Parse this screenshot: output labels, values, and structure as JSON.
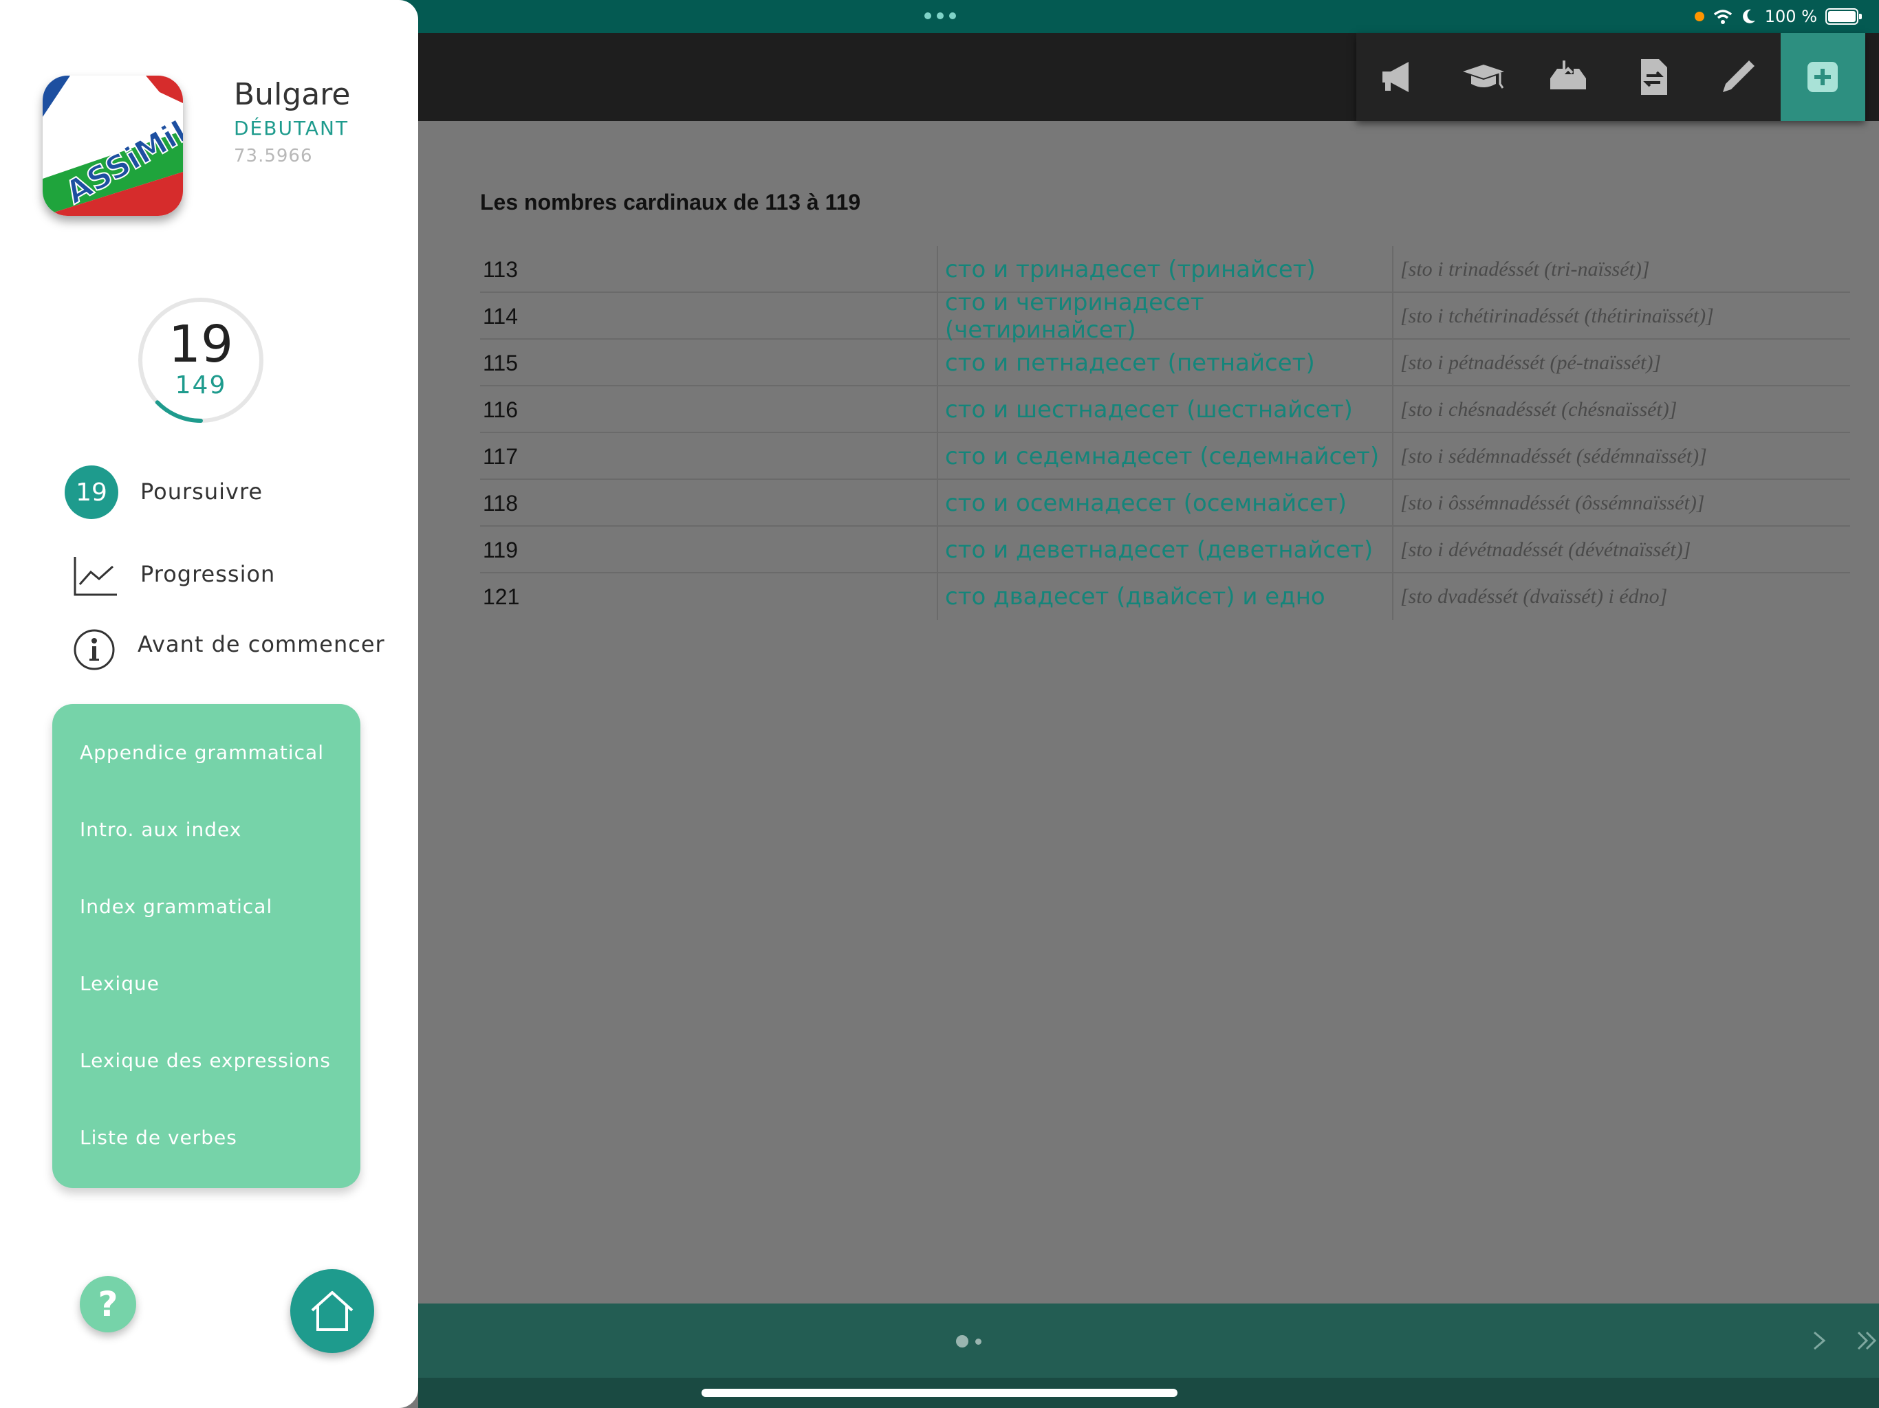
{
  "status_bar": {
    "battery_text": "100 %"
  },
  "colors": {
    "accent": "#1e9b8d",
    "panel_green": "#76d3a9",
    "status_teal": "#045a52"
  },
  "sidebar": {
    "logo_text": "ASSiMiL",
    "course_title": "Bulgare",
    "course_level": "DÉBUTANT",
    "course_code": "73.5966",
    "progress": {
      "current": "19",
      "total": "149",
      "fraction": 0.1275
    },
    "menu": [
      {
        "label": "Poursuivre",
        "badge": "19",
        "icon": "lesson-badge"
      },
      {
        "label": "Progression",
        "icon": "chart-line-icon"
      },
      {
        "label": "Avant de commencer",
        "icon": "info-icon"
      }
    ],
    "panel_items": [
      "Appendice grammatical",
      "Intro. aux index",
      "Index grammatical",
      "Lexique",
      "Lexique des expressions",
      "Liste de verbes"
    ],
    "help_label": "?",
    "icons": {
      "help": "question-icon",
      "home": "home-icon"
    }
  },
  "toolbar": {
    "tools": [
      "megaphone-icon",
      "graduation-cap-icon",
      "inbox-tray-icon",
      "document-swap-icon",
      "pencil-icon",
      "plus-square-icon"
    ]
  },
  "content": {
    "title": "Les nombres cardinaux de 113 à 119",
    "rows": [
      {
        "number": "113",
        "bulgarian": "сто и тринадесет (тринайсет)",
        "pronunciation": "[sto i trinadéssét (tri-naïssét)]"
      },
      {
        "number": "114",
        "bulgarian": "сто и четиринадесет (четиринайсет)",
        "pronunciation": "[sto i tchétirinadéssét (thétirinaïssét)]"
      },
      {
        "number": "115",
        "bulgarian": "сто и петнадесет (петнайсет)",
        "pronunciation": "[sto i pétnadéssét (pé-tnaïssét)]"
      },
      {
        "number": "116",
        "bulgarian": "сто и шестнадесет (шестнайсет)",
        "pronunciation": "[sto i chésnadéssét (chésnaïssét)]"
      },
      {
        "number": "117",
        "bulgarian": "сто и седемнадесет (седемнайсет)",
        "pronunciation": "[sto i sédémnadéssét (sédémnaïssét)]"
      },
      {
        "number": "118",
        "bulgarian": "сто и осемнадесет (осемнайсет)",
        "pronunciation": "[sto i ôssémnadéssét (ôssémnaïssét)]"
      },
      {
        "number": "119",
        "bulgarian": "сто и деветнадесет (деветнайсет)",
        "pronunciation": "[sto i dévétnadéssét (dévétnaïssét)]"
      },
      {
        "number": "121",
        "bulgarian": "сто двадесет (двайсет) и едно",
        "pronunciation": "[sto dvadéssét (dvaïssét) i édno]"
      }
    ]
  },
  "footer": {
    "page_count": 2,
    "current_page": 1,
    "icons": {
      "next": "chevron-right-icon",
      "last": "double-chevron-right-icon"
    }
  }
}
